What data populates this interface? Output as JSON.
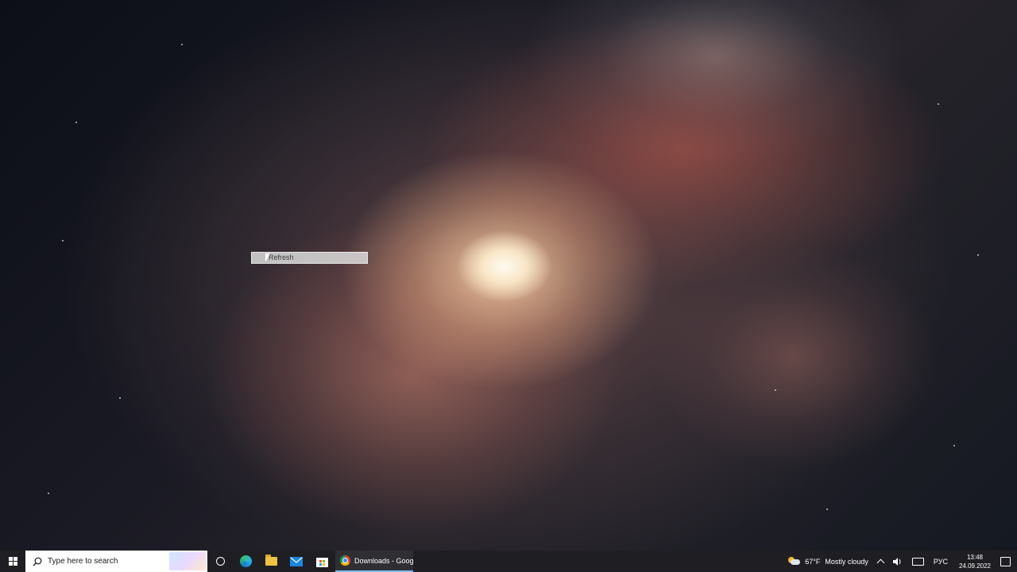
{
  "desktop": {
    "wallpaper": "spiral-galaxy",
    "context_item_label": "Refresh"
  },
  "taskbar": {
    "search_placeholder": "Type here to search",
    "pinned_icons": [
      "windows-start-icon",
      "cortana-icon",
      "edge-icon",
      "file-explorer-icon",
      "mail-icon",
      "microsoft-store-icon"
    ],
    "active_window": {
      "icon": "chrome-icon",
      "label": "Downloads - Googl..."
    },
    "tray": {
      "weather_temp": "67°F",
      "weather_text": "Mostly cloudy",
      "language": "РУС",
      "time": "13:48",
      "date": "24.09.2022"
    }
  },
  "colors": {
    "taskbar_bg": "#1f1f23",
    "active_underline": "#76b9ed",
    "search_bg": "#ffffff"
  }
}
